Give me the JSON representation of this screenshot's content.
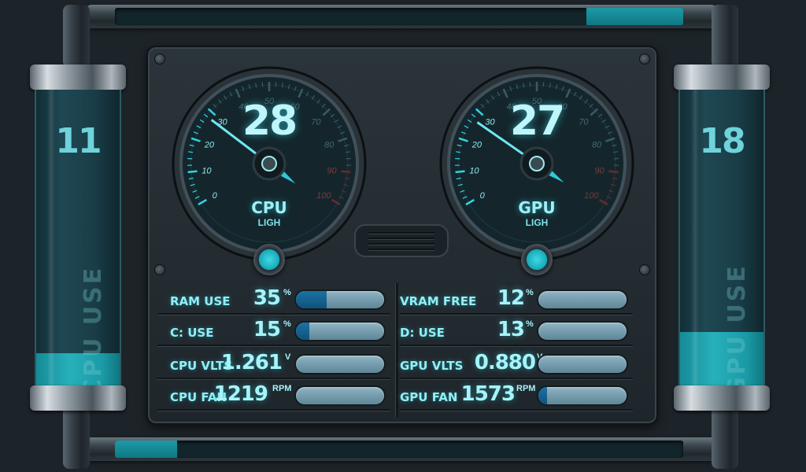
{
  "left_tube": {
    "number": "11",
    "label": "CPU USE",
    "fill_percent": 11
  },
  "right_tube": {
    "number": "18",
    "label": "GPU USE",
    "fill_percent": 18
  },
  "top_pipe": {
    "fill_percent": 17
  },
  "bottom_pipe": {
    "fill_percent": 11
  },
  "cpu_gauge": {
    "value": "28",
    "value_num": 28,
    "title": "CPU",
    "subtitle": "LIGH",
    "ticks": [
      "0",
      "10",
      "20",
      "30",
      "40",
      "50",
      "60",
      "70",
      "80",
      "90",
      "100"
    ]
  },
  "gpu_gauge": {
    "value": "27",
    "value_num": 27,
    "title": "GPU",
    "subtitle": "LIGH",
    "ticks": [
      "0",
      "10",
      "20",
      "30",
      "40",
      "50",
      "60",
      "70",
      "80",
      "90",
      "100"
    ]
  },
  "stats": {
    "ram_use": {
      "label": "RAM USE",
      "value": "35",
      "unit": "%",
      "bar_fill": 0.35
    },
    "c_use": {
      "label": "C: USE",
      "value": "15",
      "unit": "%",
      "bar_fill": 0.15
    },
    "cpu_vlts": {
      "label": "CPU VLTS",
      "value": "1.261",
      "unit": "V",
      "bar_fill": 0.0
    },
    "cpu_fan": {
      "label": "CPU FAN",
      "value": "1219",
      "unit": "RPM",
      "bar_fill": 0.0
    },
    "vram_free": {
      "label": "VRAM FREE",
      "value": "12",
      "unit": "%",
      "bar_fill": 0.0
    },
    "d_use": {
      "label": "D: USE",
      "value": "13",
      "unit": "%",
      "bar_fill": 0.0
    },
    "gpu_vlts": {
      "label": "GPU VLTS",
      "value": "0.880",
      "unit": "V",
      "bar_fill": 0.0
    },
    "gpu_fan": {
      "label": "GPU FAN",
      "value": "1573",
      "unit": "RPM",
      "bar_fill": 0.1
    }
  },
  "colors": {
    "accent": "#2fd3e0",
    "liquid": "#1e9fab",
    "bar": "#6f98a9",
    "bar_fill": "#1461a3"
  }
}
